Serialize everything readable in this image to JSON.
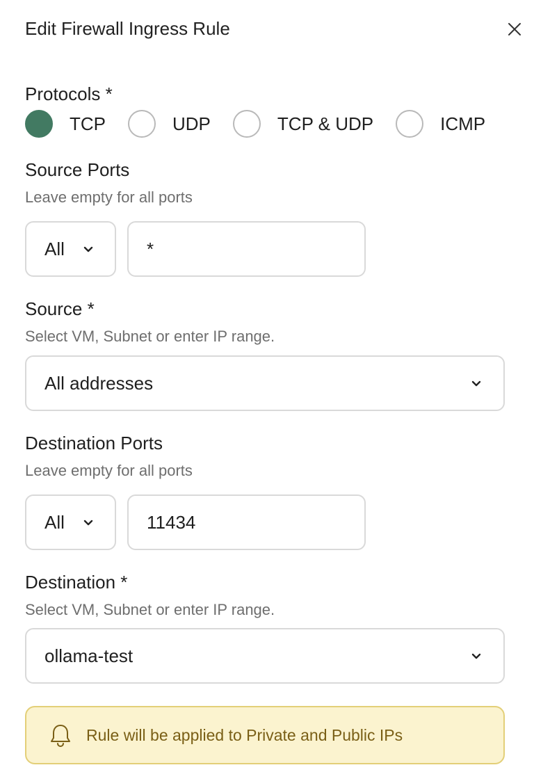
{
  "dialog": {
    "title": "Edit Firewall Ingress Rule",
    "close_icon": "close-icon"
  },
  "protocols": {
    "label": "Protocols *",
    "selected": "TCP",
    "options": [
      "TCP",
      "UDP",
      "TCP & UDP",
      "ICMP"
    ]
  },
  "source_ports": {
    "label": "Source Ports",
    "hint": "Leave empty for all ports",
    "mode_value": "All",
    "port_value": "*"
  },
  "source": {
    "label": "Source *",
    "hint": "Select VM, Subnet or enter IP range.",
    "value": "All addresses"
  },
  "destination_ports": {
    "label": "Destination Ports",
    "hint": "Leave empty for all ports",
    "mode_value": "All",
    "port_value": "11434"
  },
  "destination": {
    "label": "Destination *",
    "hint": "Select VM, Subnet or enter IP range.",
    "value": "ollama-test"
  },
  "notice": {
    "icon": "bell-icon",
    "text": "Rule will be applied to Private and Public IPs"
  },
  "colors": {
    "accent": "#427a62",
    "notice_bg": "#fbf3cf",
    "notice_border": "#e3cf78",
    "notice_text": "#7a5f16"
  }
}
